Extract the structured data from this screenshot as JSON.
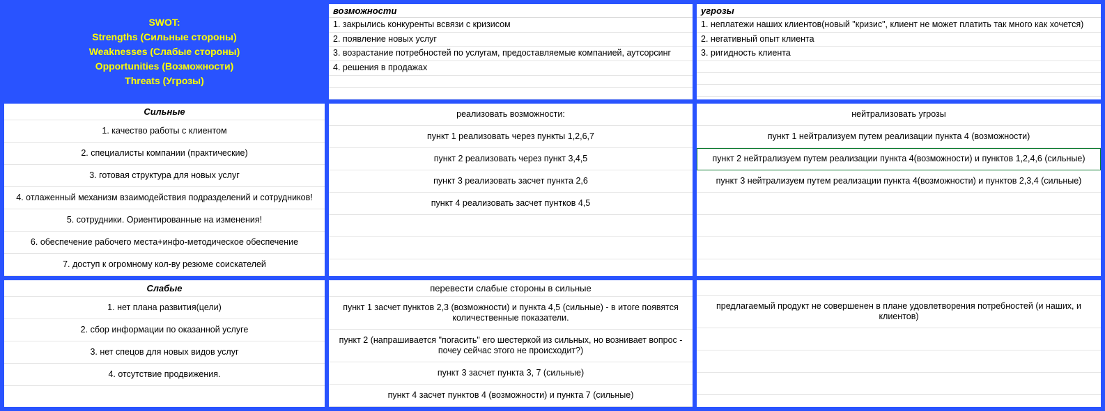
{
  "header": {
    "line1": "SWOT:",
    "line2": "Strengths (Сильные стороны)",
    "line3": "Weaknesses (Слабые стороны)",
    "line4": "Opportunities (Возможности)",
    "line5": "Threats (Угрозы)"
  },
  "opportunities": {
    "title": "возможности",
    "items": [
      "1. закрылись конкуренты всвязи с кризисом",
      "2. появление новых услуг",
      "3. возрастание потребностей по услугам, предоставляемые компанией, аутсорсинг",
      "4. решения в продажах",
      "",
      ""
    ]
  },
  "threats": {
    "title": "угрозы",
    "items": [
      "1. неплатежи наших клиентов(новый \"кризис\", клиент не может платить так много как хочется)",
      "2. негативный опыт клиента",
      "3. ригидность клиента",
      "",
      "",
      ""
    ]
  },
  "strengths": {
    "title": "Сильные",
    "items": [
      "1. качество работы с клиентом",
      "2. специалисты компании (практические)",
      "3. готовая структура для новых услуг",
      "4. отлаженный механизм взаимодействия подразделений и сотрудников!",
      "5. сотрудники. Ориентированные на изменения!",
      "6. обеспечение рабочего места+инфо-методическое обеспечение",
      "7. доступ к огромному кол-ву резюме соискателей"
    ]
  },
  "so": {
    "title": "реализовать возможности:",
    "rows": [
      "пункт 1 реализовать через пункты 1,2,6,7",
      "пункт 2 реализовать через пункт 3,4,5",
      "пункт 3 реализовать засчет пункта 2,6",
      "пункт 4 реализовать засчет пунтков 4,5",
      "",
      ""
    ]
  },
  "st": {
    "title": "нейтрализовать угрозы",
    "rows": [
      "пункт 1 нейтрализуем путем реализации пункта 4 (возможности)",
      "пункт 2 нейтрализуем путем реализации пункта 4(возможности) и пунктов 1,2,4,6 (сильные)",
      "пункт 3 нейтрализуем путем реализации пункта 4(возможности) и пунктов 2,3,4 (сильные)",
      "",
      "",
      ""
    ]
  },
  "weaknesses": {
    "title": "Слабые",
    "items": [
      "1. нет плана развития(цели)",
      "2. сбор информации по оказанной услуге",
      "3. нет спецов для новых видов услуг",
      "4. отсутствие продвижения."
    ]
  },
  "wo": {
    "title": "перевести слабые стороны в сильные",
    "rows": [
      "пункт 1 засчет пунктов 2,3 (возможности) и пункта 4,5 (сильные) - в итоге появятся количественные показатели.",
      "пункт 2 (напрашивается \"погасить\" его шестеркой из сильных, но вознивает вопрос - почеу сейчас этого не происходит?)",
      "пункт 3 засчет пункта 3, 7 (сильные)",
      "пункт 4 засчет пунктов 4 (возможности) и пункта 7 (сильные)"
    ]
  },
  "wt": {
    "title": "",
    "rows": [
      "предлагаемый продукт не совершенен в плане удовлетворения потребностей (и наших, и клиентов)",
      "",
      "",
      ""
    ]
  }
}
